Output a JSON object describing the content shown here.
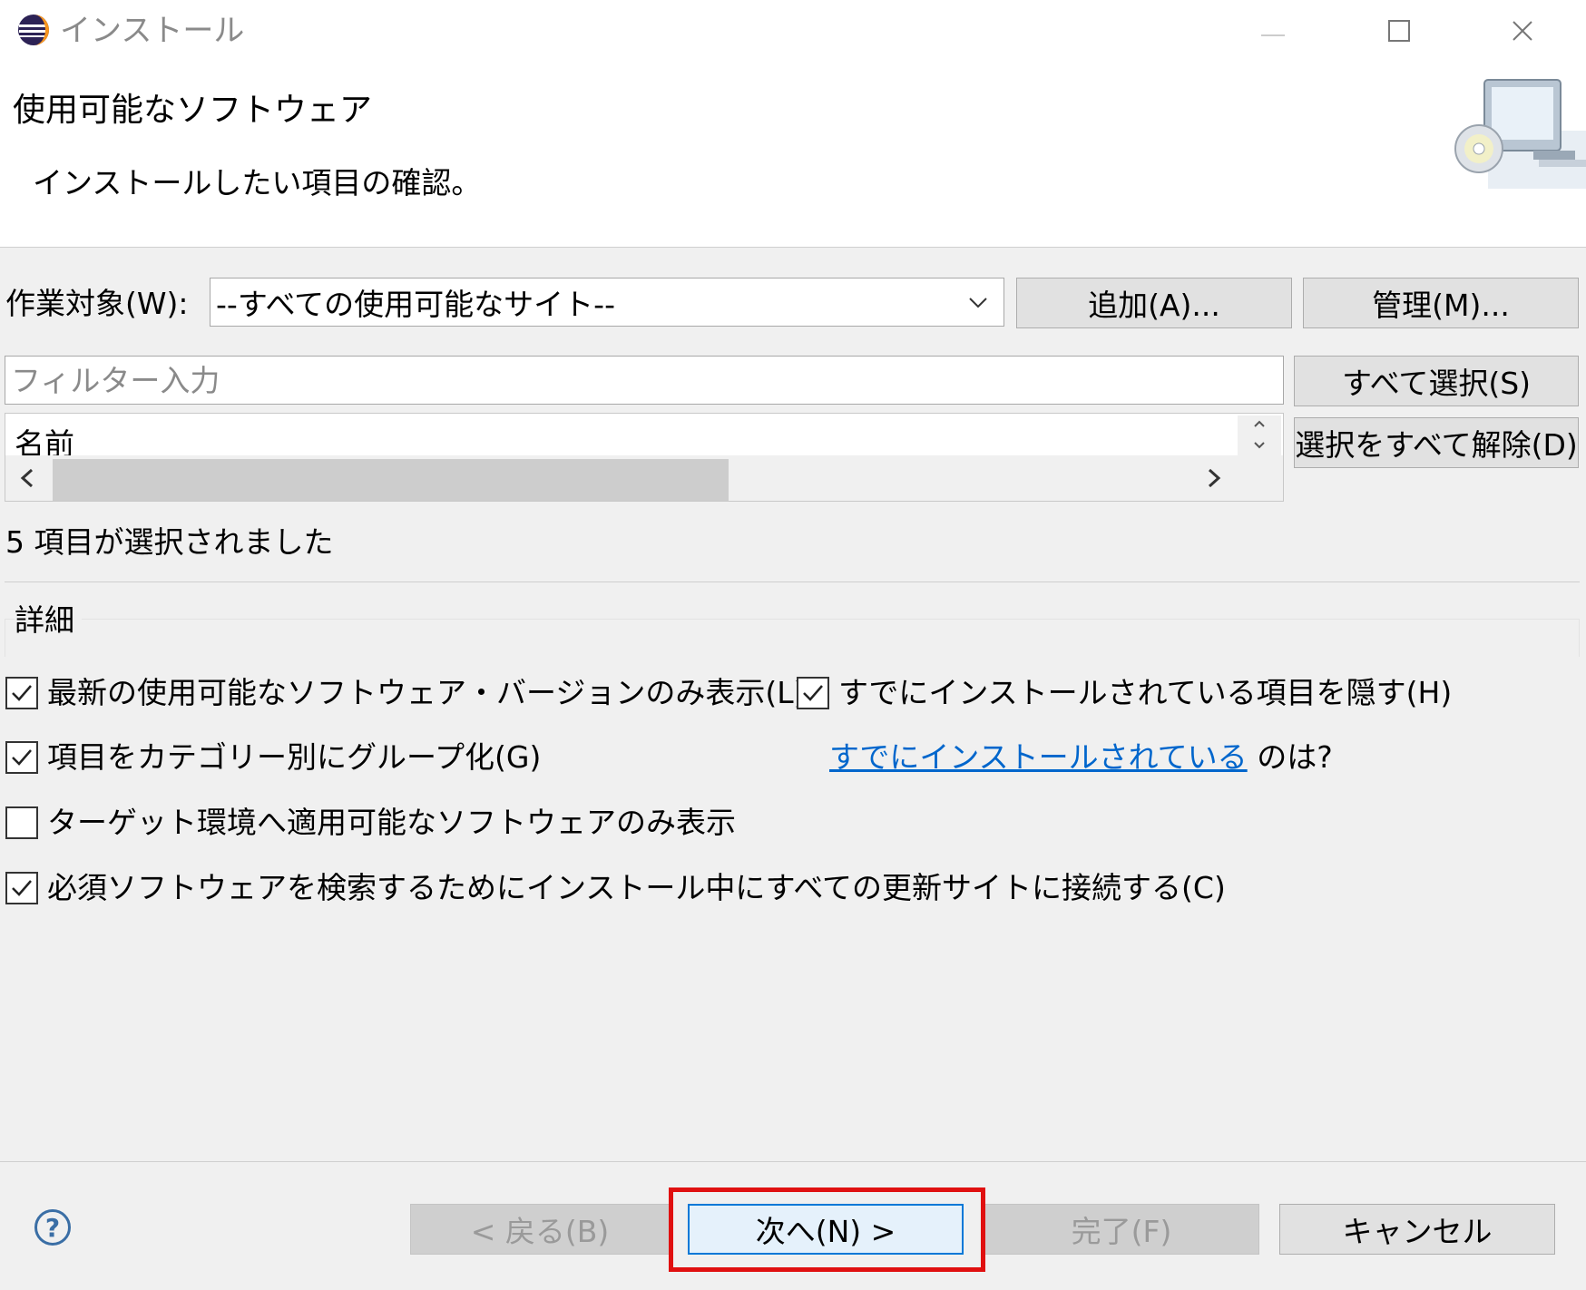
{
  "window": {
    "title": "インストール"
  },
  "header": {
    "title": "使用可能なソフトウェア",
    "description": "インストールしたい項目の確認。"
  },
  "work_with": {
    "label": "作業対象(W):",
    "selected": "--すべての使用可能なサイト--",
    "add_button": "追加(A)...",
    "manage_button": "管理(M)..."
  },
  "filter": {
    "placeholder": "フィルター入力",
    "select_all_button": "すべて選択(S)",
    "deselect_all_button": "選択をすべて解除(D)"
  },
  "tree": {
    "column_name": "名前"
  },
  "status": "5 項目が選択されました",
  "details": {
    "title": "詳細",
    "options": {
      "latest_only": {
        "label": "最新の使用可能なソフトウェア・バージョンのみ表示(L)",
        "checked": true
      },
      "hide_installed": {
        "label": "すでにインストールされている項目を隠す(H)",
        "checked": true
      },
      "group_by_category": {
        "label": "項目をカテゴリー別にグループ化(G)",
        "checked": true
      },
      "target_env_only": {
        "label": "ターゲット環境へ適用可能なソフトウェアのみ表示",
        "checked": false
      },
      "contact_all_sites": {
        "label": "必須ソフトウェアを検索するためにインストール中にすべての更新サイトに接続する(C)",
        "checked": true
      }
    },
    "installed_link": "すでにインストールされている",
    "installed_suffix": "のは?"
  },
  "footer": {
    "back_button": "< 戻る(B)",
    "next_button": "次へ(N) >",
    "finish_button": "完了(F)",
    "cancel_button": "キャンセル"
  },
  "colors": {
    "link": "#0066cc",
    "highlight": "#e01010",
    "default_button_border": "#0078d7"
  }
}
